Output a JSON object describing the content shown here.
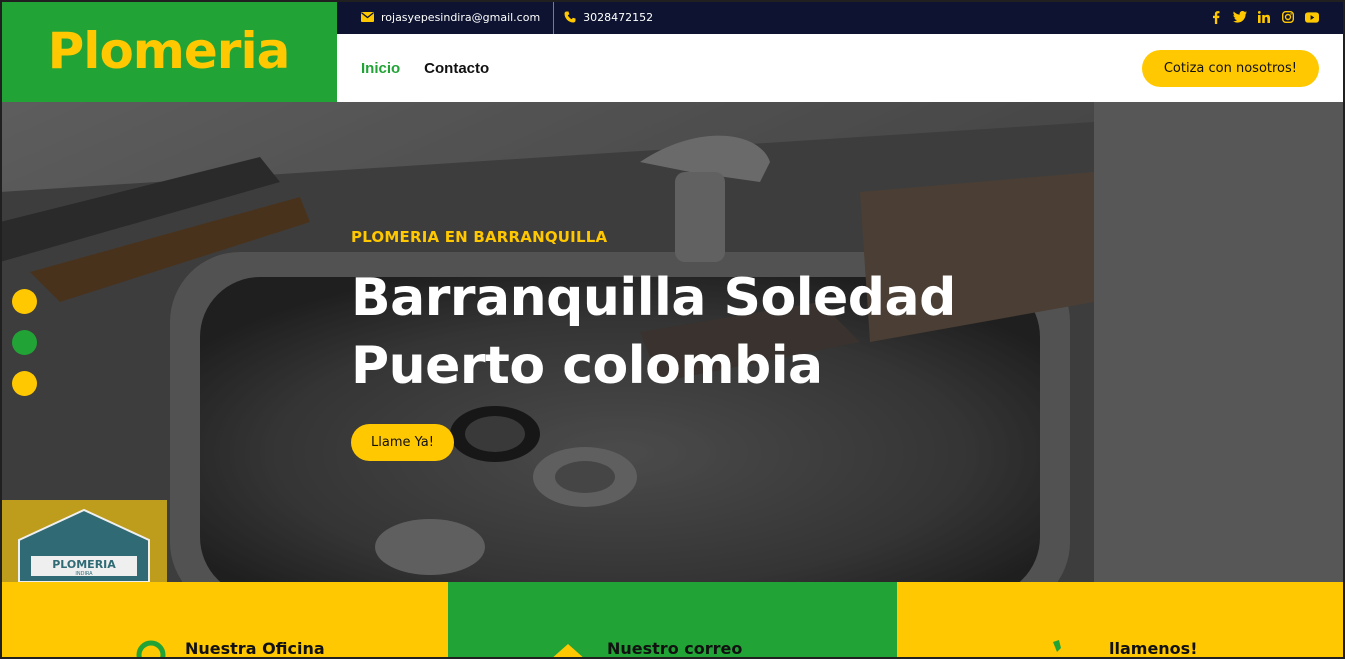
{
  "brand": {
    "logo": "Plomeria"
  },
  "topbar": {
    "email": "rojasyepesindira@gmail.com",
    "phone": "3028472152",
    "social_icons": [
      "facebook-icon",
      "twitter-icon",
      "linkedin-icon",
      "instagram-icon",
      "youtube-icon"
    ]
  },
  "nav": {
    "items": [
      {
        "label": "Inicio",
        "active": true
      },
      {
        "label": "Contacto",
        "active": false
      }
    ],
    "cta": "Cotiza con nosotros!"
  },
  "hero": {
    "kicker": "PLOMERIA EN BARRANQUILLA",
    "title_line1": "Barranquilla Soledad",
    "title_line2": "Puerto colombia",
    "button": "Llame Ya!",
    "slide_count": 3,
    "badge_text": "PLOMERIA",
    "badge_sub": "INDIRA"
  },
  "info": [
    {
      "title": "Nuestra Oficina",
      "icon": "map-pin-icon"
    },
    {
      "title": "Nuestro correo",
      "icon": "envelope-icon"
    },
    {
      "title": "llamenos!",
      "icon": "phone-icon"
    }
  ],
  "colors": {
    "green": "#21a336",
    "yellow": "#ffc800",
    "navy": "#0d1330"
  }
}
